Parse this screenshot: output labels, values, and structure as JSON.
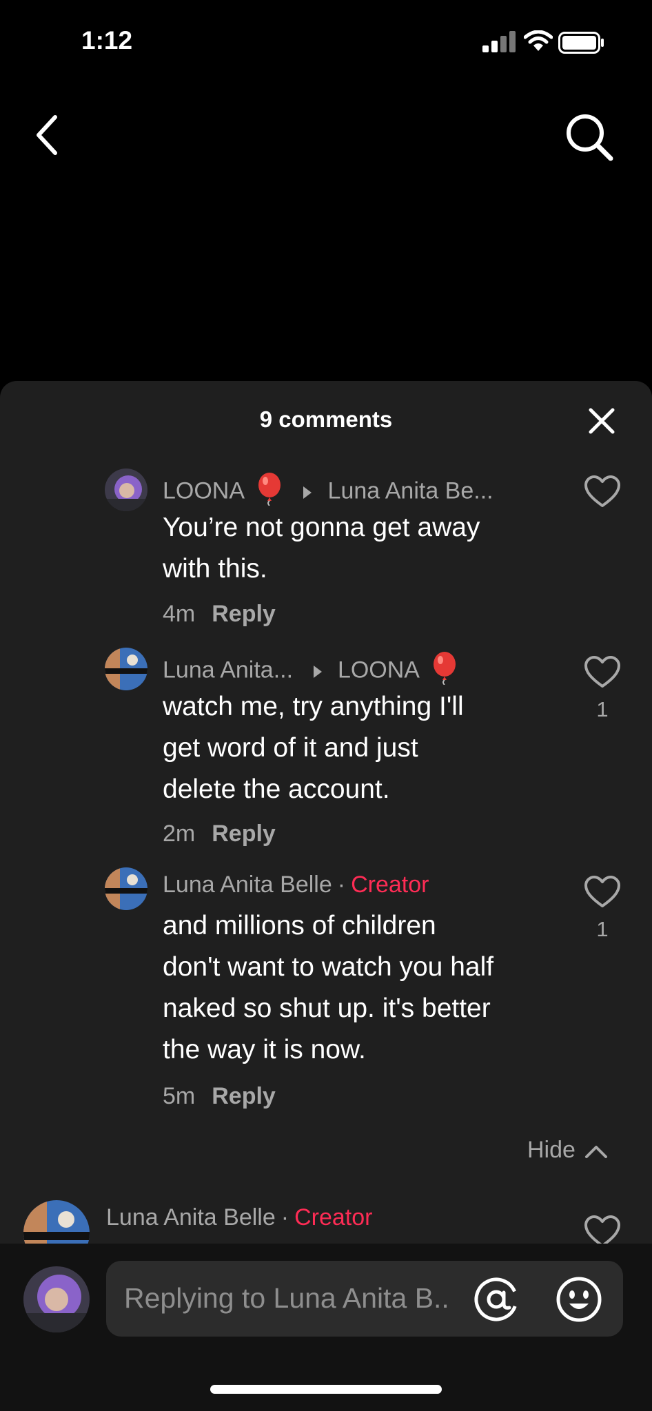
{
  "status_bar": {
    "time": "1:12"
  },
  "sheet": {
    "title": "9 comments"
  },
  "comments": [
    {
      "user": "LOONA",
      "reply_to": "Luna Anita Be...",
      "text_lines": [
        "You’re not gonna get away",
        "with this."
      ],
      "time": "4m",
      "reply_label": "Reply",
      "likes": ""
    },
    {
      "user": "Luna Anita...",
      "reply_to": "LOONA",
      "text_lines": [
        "watch me, try anything I'll",
        "get word of it and just",
        "delete the account."
      ],
      "time": "2m",
      "reply_label": "Reply",
      "likes": "1"
    },
    {
      "user": "Luna Anita Belle",
      "badge": "Creator",
      "text_lines": [
        "and millions of children",
        "don't want to watch you half",
        "naked so shut up. it's better",
        "the way it is now."
      ],
      "time": "5m",
      "reply_label": "Reply",
      "likes": "1"
    },
    {
      "user": "Luna Anita Belle",
      "badge": "Creator"
    }
  ],
  "hide_label": "Hide",
  "input": {
    "placeholder": "Replying to Luna Anita B.."
  },
  "colors": {
    "background": "#000000",
    "sheet": "#1f1f1f",
    "creator": "#fe2c55",
    "muted": "#a8a8a8"
  },
  "icons": [
    "back-icon",
    "search-icon",
    "close-icon",
    "heart-icon",
    "balloon-icon",
    "mention-icon",
    "emoji-icon"
  ]
}
